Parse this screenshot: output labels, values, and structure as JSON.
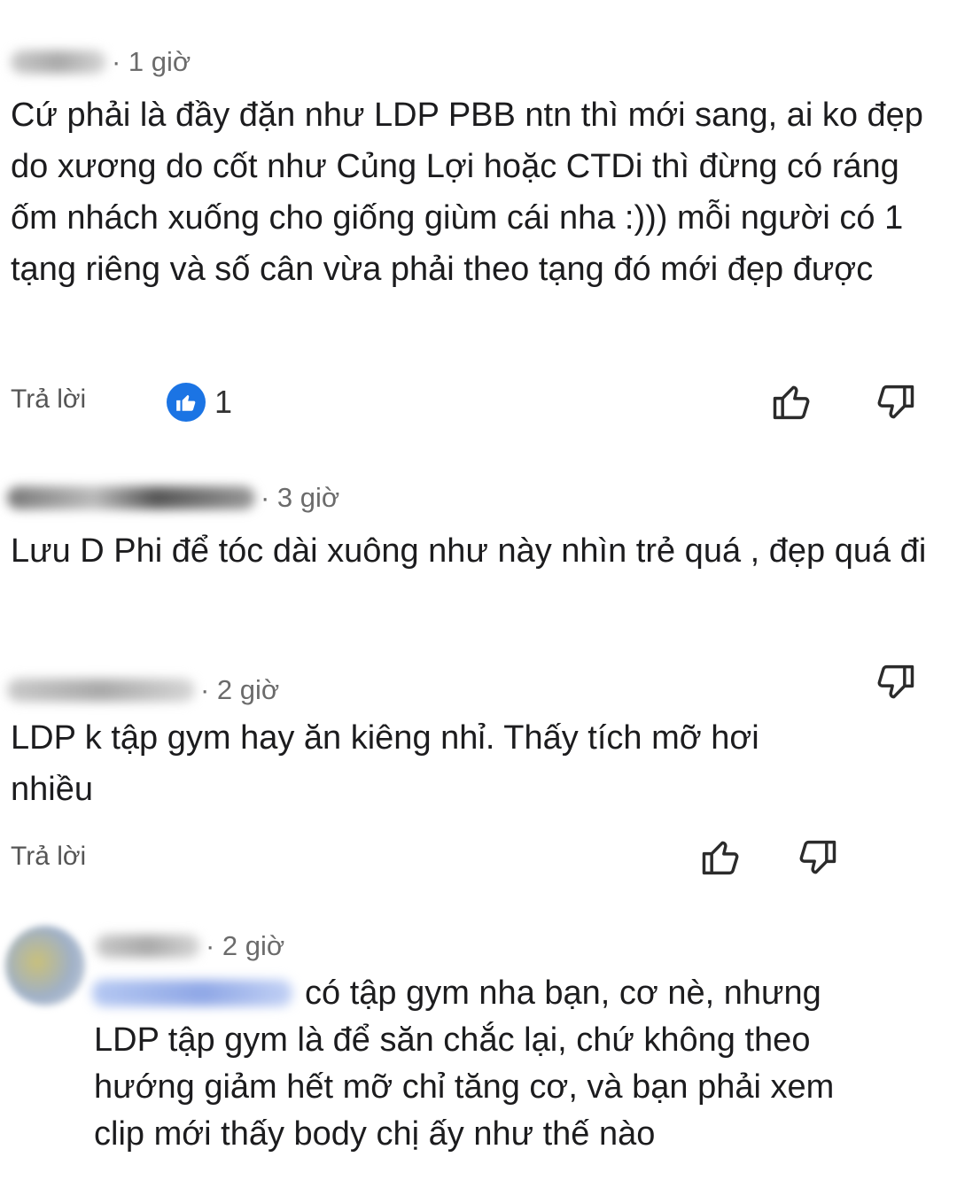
{
  "comments": [
    {
      "time": "· 1 giờ",
      "text": "Cứ phải là đầy đặn như LDP PBB ntn thì mới sang, ai ko đẹp do xương do cốt như Củng Lợi hoặc CTDi thì đừng có ráng ốm nhách xuống cho giống giùm cái nha :))) mỗi người có 1 tạng riêng và số cân vừa phải theo tạng đó mới đẹp được",
      "reply_label": "Trả lời",
      "like_count": "1"
    },
    {
      "time": "· 3 giờ",
      "text": "Lưu D Phi để tóc dài xuông như này nhìn trẻ quá , đẹp quá đi"
    },
    {
      "time": "· 2 giờ",
      "text": "LDP k tập gym hay ăn kiêng nhỉ. Thấy tích mỡ hơi nhiều",
      "reply_label": "Trả lời"
    },
    {
      "time": "· 2 giờ",
      "text": "có tập gym nha bạn, cơ nè, nhưng LDP tập gym là để săn chắc lại, chứ không theo hướng giảm hết mỡ chỉ tăng cơ, và bạn phải xem clip mới thấy body chị ấy như thế nào"
    }
  ],
  "colors": {
    "like_badge": "#1b74e4",
    "text": "#1c1c1e",
    "muted": "#6b6b6b"
  },
  "icons": [
    "thumbs-up-icon",
    "thumbs-down-icon",
    "like-badge-icon"
  ]
}
